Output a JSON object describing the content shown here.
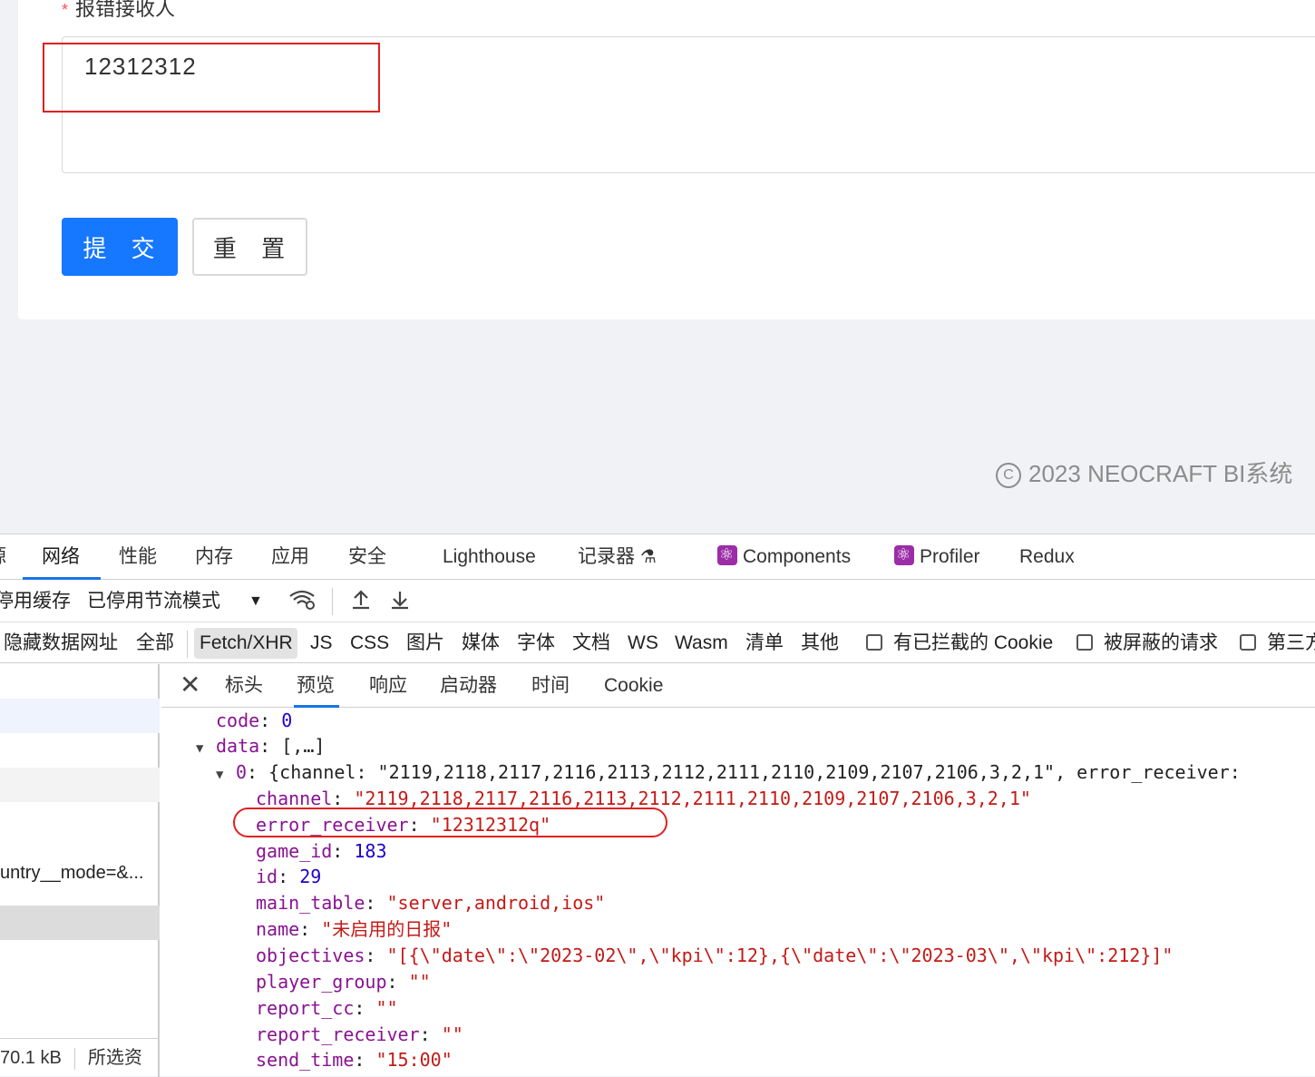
{
  "form": {
    "label": "报错接收人",
    "required_mark": "*",
    "textarea_value": "12312312",
    "submit_label": "提 交",
    "reset_label": "重 置"
  },
  "footer": {
    "copyright_symbol": "C",
    "text": "2023 NEOCRAFT BI系统"
  },
  "devtools": {
    "tabs": [
      {
        "label": "源"
      },
      {
        "label": "网络"
      },
      {
        "label": "性能"
      },
      {
        "label": "内存"
      },
      {
        "label": "应用"
      },
      {
        "label": "安全"
      },
      {
        "label": "Lighthouse"
      },
      {
        "label": "记录器"
      },
      {
        "label": "Components"
      },
      {
        "label": "Profiler"
      },
      {
        "label": "Redux"
      }
    ],
    "toolbar": {
      "disable_cache": "停用缓存",
      "throttle": "已停用节流模式"
    },
    "filters": {
      "hide_data_urls": "隐藏数据网址",
      "types": [
        "全部",
        "Fetch/XHR",
        "JS",
        "CSS",
        "图片",
        "媒体",
        "字体",
        "文档",
        "WS",
        "Wasm",
        "清单",
        "其他"
      ],
      "blocked_cookies": "有已拦截的 Cookie",
      "blocked_requests": "被屏蔽的请求",
      "third_party": "第三方"
    },
    "request_list": {
      "visible_row_text": "untry__mode=&...",
      "status_size": "70.1 kB",
      "status_selected": "所选资"
    },
    "detail_tabs": [
      "标头",
      "预览",
      "响应",
      "启动器",
      "时间",
      "Cookie"
    ],
    "preview": {
      "code_key": "code",
      "code_value": "0",
      "data_key": "data",
      "data_summary": "[,…]",
      "item_index": "0",
      "item_summary": "{channel: \"2119,2118,2117,2116,2113,2112,2111,2110,2109,2107,2106,3,2,1\", error_receiver:",
      "fields": [
        {
          "key": "channel",
          "value": "\"2119,2118,2117,2116,2113,2112,2111,2110,2109,2107,2106,3,2,1\"",
          "type": "string"
        },
        {
          "key": "error_receiver",
          "value": "\"12312312q\"",
          "type": "string"
        },
        {
          "key": "game_id",
          "value": "183",
          "type": "number"
        },
        {
          "key": "id",
          "value": "29",
          "type": "number"
        },
        {
          "key": "main_table",
          "value": "\"server,android,ios\"",
          "type": "string"
        },
        {
          "key": "name",
          "value": "\"未启用的日报\"",
          "type": "string"
        },
        {
          "key": "objectives",
          "value": "\"[{\\\"date\\\":\\\"2023-02\\\",\\\"kpi\\\":12},{\\\"date\\\":\\\"2023-03\\\",\\\"kpi\\\":212}]\"",
          "type": "string"
        },
        {
          "key": "player_group",
          "value": "\"\"",
          "type": "string"
        },
        {
          "key": "report_cc",
          "value": "\"\"",
          "type": "string"
        },
        {
          "key": "report_receiver",
          "value": "\"\"",
          "type": "string"
        },
        {
          "key": "send_time",
          "value": "\"15:00\"",
          "type": "string"
        }
      ]
    }
  },
  "colors": {
    "primary": "#1677ff",
    "annotation_red": "#e02020",
    "json_key": "#881391",
    "json_string": "#c41a16",
    "json_number": "#1c00cf"
  }
}
